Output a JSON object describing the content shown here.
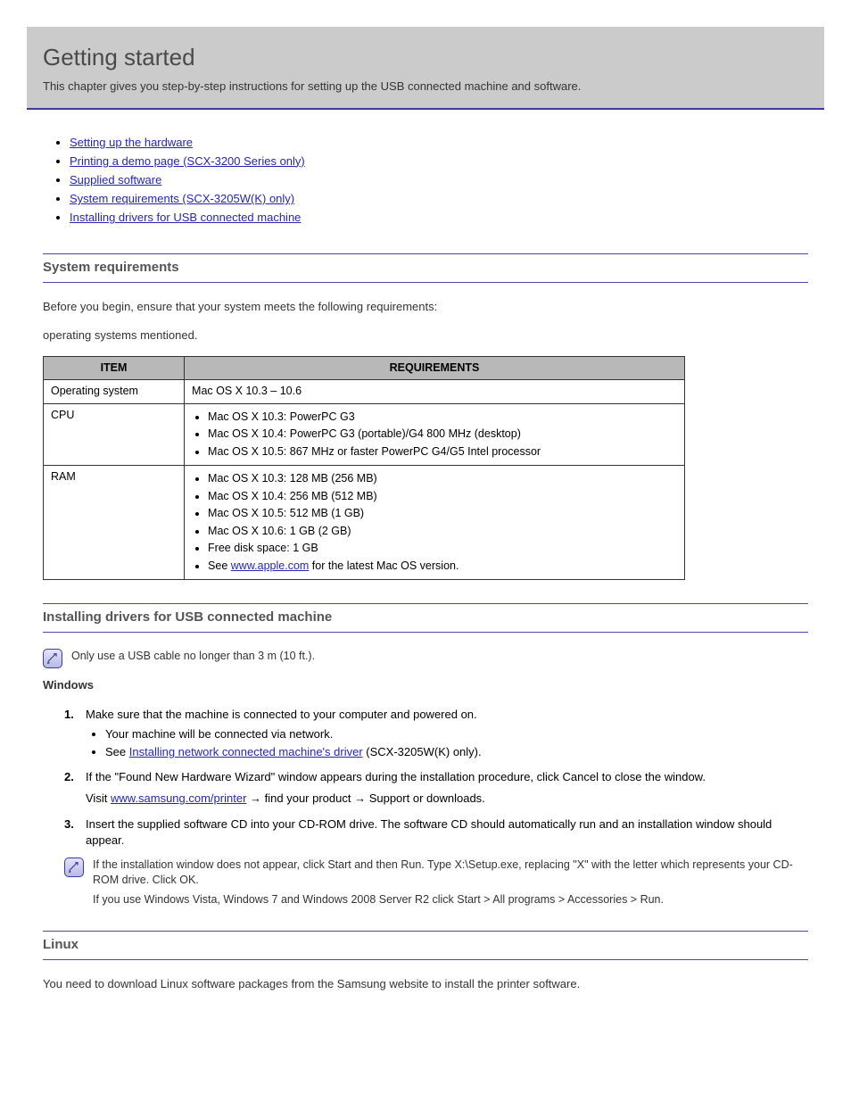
{
  "banner": {
    "title": "Getting started",
    "subtitle": "This chapter gives you step-by-step instructions for setting up the USB connected machine and software."
  },
  "toc": {
    "items": [
      "Setting up the hardware",
      "Printing a demo page (SCX-3200 Series only)",
      "Supplied software",
      "System requirements (SCX-3205W(K) only)",
      "Installing drivers for USB connected machine"
    ]
  },
  "sections": {
    "sysreq": {
      "title": "System requirements",
      "intro": "Before you begin, ensure that your system meets the following requirements:",
      "os_suffix": "operating systems mentioned.",
      "table": {
        "headers": [
          "ITEM",
          "REQUIREMENTS"
        ],
        "rows": [
          {
            "item": "Operating system",
            "reqs": [
              "Mac OS X 10.3 – 10.6"
            ]
          },
          {
            "item": "CPU",
            "reqs": [
              "Mac OS X 10.3: PowerPC G3",
              "Mac OS X 10.4: PowerPC G3 (portable)/G4 800 MHz (desktop)",
              "Mac OS X 10.5: 867 MHz or faster PowerPC G4/G5 Intel processor"
            ]
          },
          {
            "item": "RAM",
            "reqs": [
              "Mac OS X 10.3: 128 MB (256 MB)",
              "Mac OS X 10.4: 256 MB (512 MB)",
              "Mac OS X 10.5: 512 MB (1 GB)",
              "Mac OS X 10.6: 1 GB (2 GB)",
              "Free disk space: 1 GB",
              "See",
              "www.apple.com"
            ],
            "see_text": "for the latest Mac OS version."
          }
        ]
      }
    },
    "install": {
      "title": "Installing drivers for USB connected machine",
      "note1": "Only use a USB cable no longer than 3 m (10 ft.).",
      "note2": "If the installation window does not appear, click Start and then Run. Type X:\\Setup.exe, replacing \"X\" with the letter which represents your CD-ROM drive. Click OK.",
      "note3": "If you use Windows Vista, Windows 7 and Windows 2008 Server R2 click Start > All programs > Accessories > Run.",
      "win_header": "Windows",
      "steps": [
        {
          "text": "Make sure that the machine is connected to your computer and powered on."
        },
        {
          "text": "If the \"Found New Hardware Wizard\" window appears during the installation procedure, click Cancel to close the window."
        },
        {
          "text": "Insert the supplied software CD into your CD-ROM drive. The software CD should automatically run and an installation window should appear."
        }
      ],
      "step1_sub": [
        "Your machine will be connected via network.",
        "See",
        "Installing network connected machine's driver",
        "(SCX-3205W(K) only)."
      ],
      "inline_see_link": "www.samsung.com/printer",
      "inline_see_prefix": "Visit",
      "inline_see_suffix": "→ find your product → Support or downloads."
    },
    "linux": {
      "title": "Linux",
      "intro": "You need to download Linux software packages from the Samsung website to install the printer software."
    }
  }
}
